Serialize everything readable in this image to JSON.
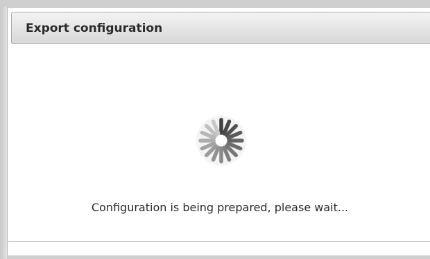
{
  "dialog": {
    "title": "Export configuration",
    "status_message": "Configuration is being prepared, please wait...",
    "spinner_icon": "loading-spinner-icon"
  },
  "colors": {
    "title_bar_top": "#f3f3f3",
    "title_bar_bottom": "#d9d9d9",
    "spinner_dark": "#404040",
    "spinner_light": "#c8c8c8"
  }
}
